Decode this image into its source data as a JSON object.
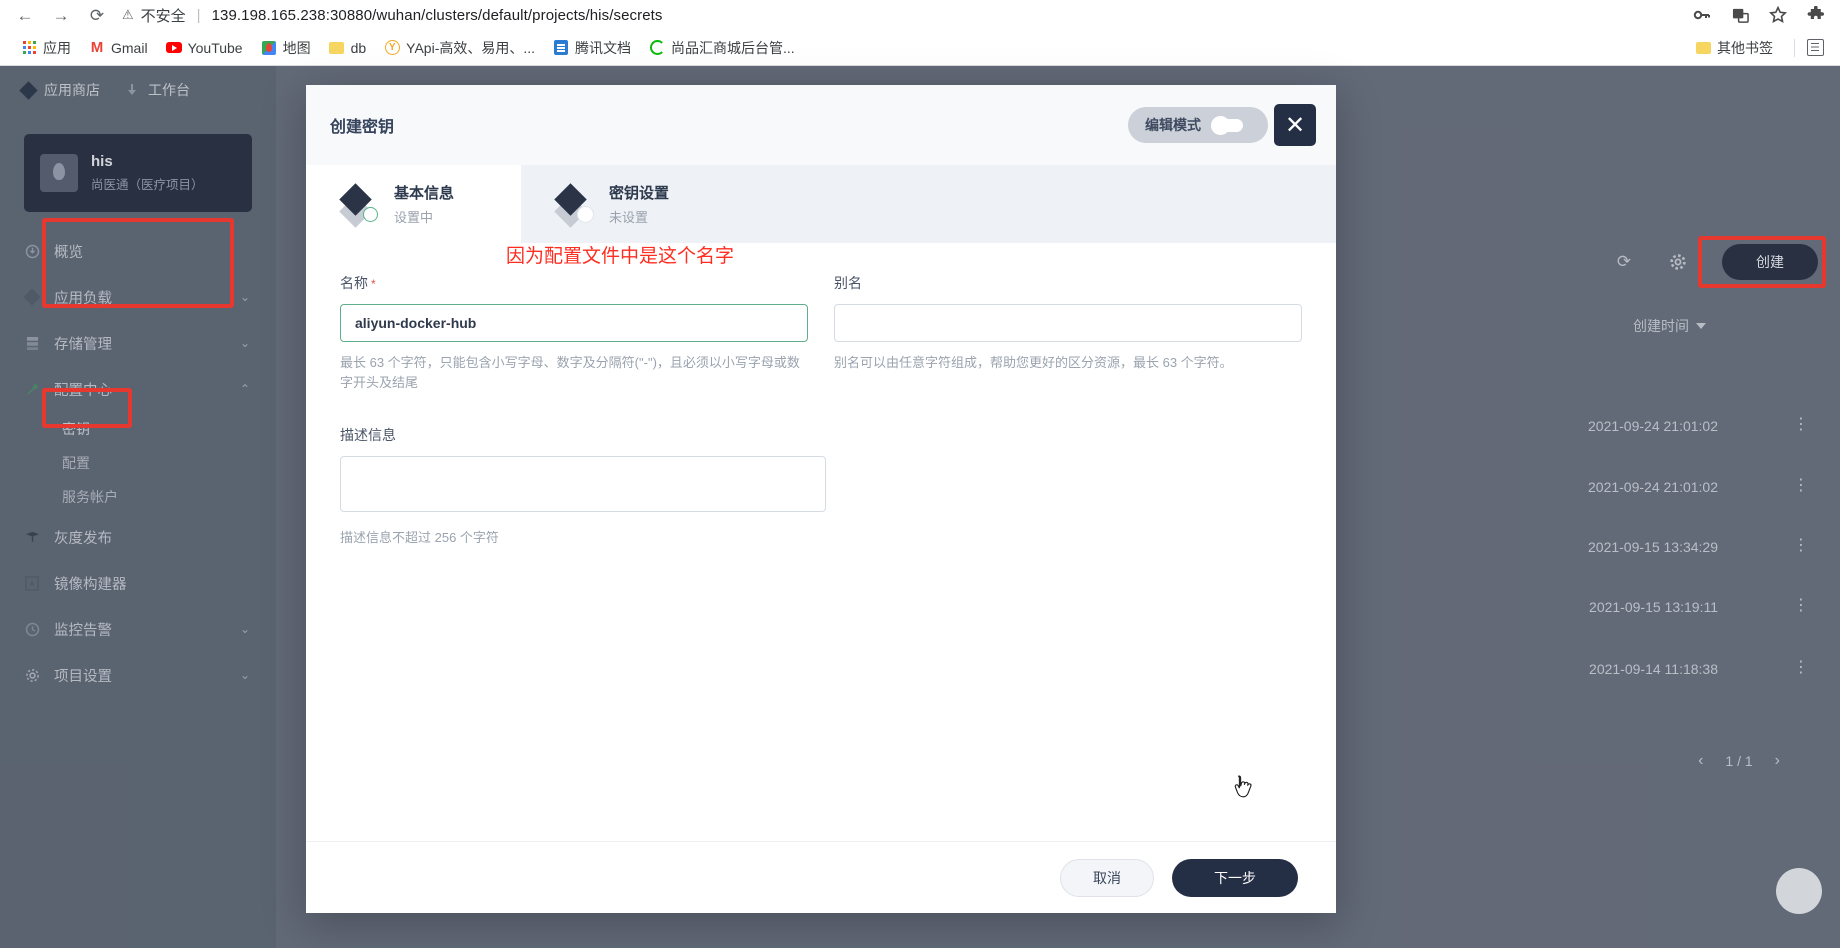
{
  "browser": {
    "back_icon": "back-arrow-icon",
    "forward_icon": "forward-arrow-icon",
    "reload_icon": "reload-icon",
    "security_label": "不安全",
    "url": "139.198.165.238:30880/wuhan/clusters/default/projects/his/secrets",
    "bookmarks": [
      {
        "label": "应用",
        "icon": "apps-grid-icon"
      },
      {
        "label": "Gmail",
        "icon": "gmail-icon"
      },
      {
        "label": "YouTube",
        "icon": "youtube-icon"
      },
      {
        "label": "地图",
        "icon": "google-maps-icon"
      },
      {
        "label": "db",
        "icon": "folder-icon"
      },
      {
        "label": "YApi-高效、易用、...",
        "icon": "yapi-icon"
      },
      {
        "label": "腾讯文档",
        "icon": "tencent-docs-icon"
      },
      {
        "label": "尚品汇商城后台管...",
        "icon": "shangpinhui-icon"
      }
    ],
    "other_bookmarks": "其他书签"
  },
  "app": {
    "top_nav": [
      {
        "label": "应用商店",
        "icon": "app-store-icon"
      },
      {
        "label": "工作台",
        "icon": "workbench-icon"
      }
    ],
    "project": {
      "name": "his",
      "description": "尚医通（医疗项目）"
    },
    "menu": [
      {
        "label": "概览",
        "icon": "overview-icon",
        "expandable": false
      },
      {
        "label": "应用负载",
        "icon": "workload-icon",
        "expandable": true,
        "chevron": "⌄"
      },
      {
        "label": "存储管理",
        "icon": "storage-icon",
        "expandable": true,
        "chevron": "⌄"
      },
      {
        "label": "配置中心",
        "icon": "config-icon",
        "expandable": true,
        "chevron": "⌃",
        "expanded": true
      },
      {
        "label": "灰度发布",
        "icon": "grayscale-release-icon",
        "expandable": false
      },
      {
        "label": "镜像构建器",
        "icon": "image-builder-icon",
        "expandable": false
      },
      {
        "label": "监控告警",
        "icon": "monitoring-icon",
        "expandable": true,
        "chevron": "⌄"
      },
      {
        "label": "项目设置",
        "icon": "settings-icon",
        "expandable": true,
        "chevron": "⌄"
      }
    ],
    "submenu": [
      {
        "label": "密钥",
        "active": true
      },
      {
        "label": "配置",
        "active": false
      },
      {
        "label": "服务帐户",
        "active": false
      }
    ],
    "toolbar": {
      "refresh_icon": "refresh-icon",
      "settings_icon": "gear-icon",
      "create_label": "创建"
    },
    "table": {
      "column_header": "创建时间",
      "rows": [
        {
          "created": "2021-09-24 21:01:02"
        },
        {
          "created": "2021-09-24 21:01:02"
        },
        {
          "created": "2021-09-15 13:34:29"
        },
        {
          "created": "2021-09-15 13:19:11"
        },
        {
          "created": "2021-09-14 11:18:38"
        }
      ]
    },
    "pagination": {
      "prev": "‹",
      "text": "1 / 1",
      "next": "›"
    }
  },
  "modal": {
    "title": "创建密钥",
    "edit_mode_label": "编辑模式",
    "close_icon": "close-icon",
    "steps": [
      {
        "name": "基本信息",
        "status": "设置中",
        "active": true
      },
      {
        "name": "密钥设置",
        "status": "未设置",
        "active": false
      }
    ],
    "annotation": "因为配置文件中是这个名字",
    "fields": {
      "name_label": "名称",
      "name_required": "*",
      "name_value": "aliyun-docker-hub",
      "name_placeholder": "",
      "name_hint": "最长 63 个字符，只能包含小写字母、数字及分隔符(\"-\")，且必须以小写字母或数字开头及结尾",
      "alias_label": "别名",
      "alias_value": "",
      "alias_placeholder": "",
      "alias_hint": "别名可以由任意字符组成，帮助您更好的区分资源，最长 63 个字符。",
      "description_label": "描述信息",
      "description_value": "",
      "description_placeholder": "",
      "description_hint": "描述信息不超过 256 个字符"
    },
    "buttons": {
      "cancel": "取消",
      "next": "下一步"
    }
  },
  "colors": {
    "accent_dark": "#242f45",
    "highlight_red": "#ff3b30",
    "valid_green": "#5fae8c",
    "sidebar": "#636b79"
  }
}
